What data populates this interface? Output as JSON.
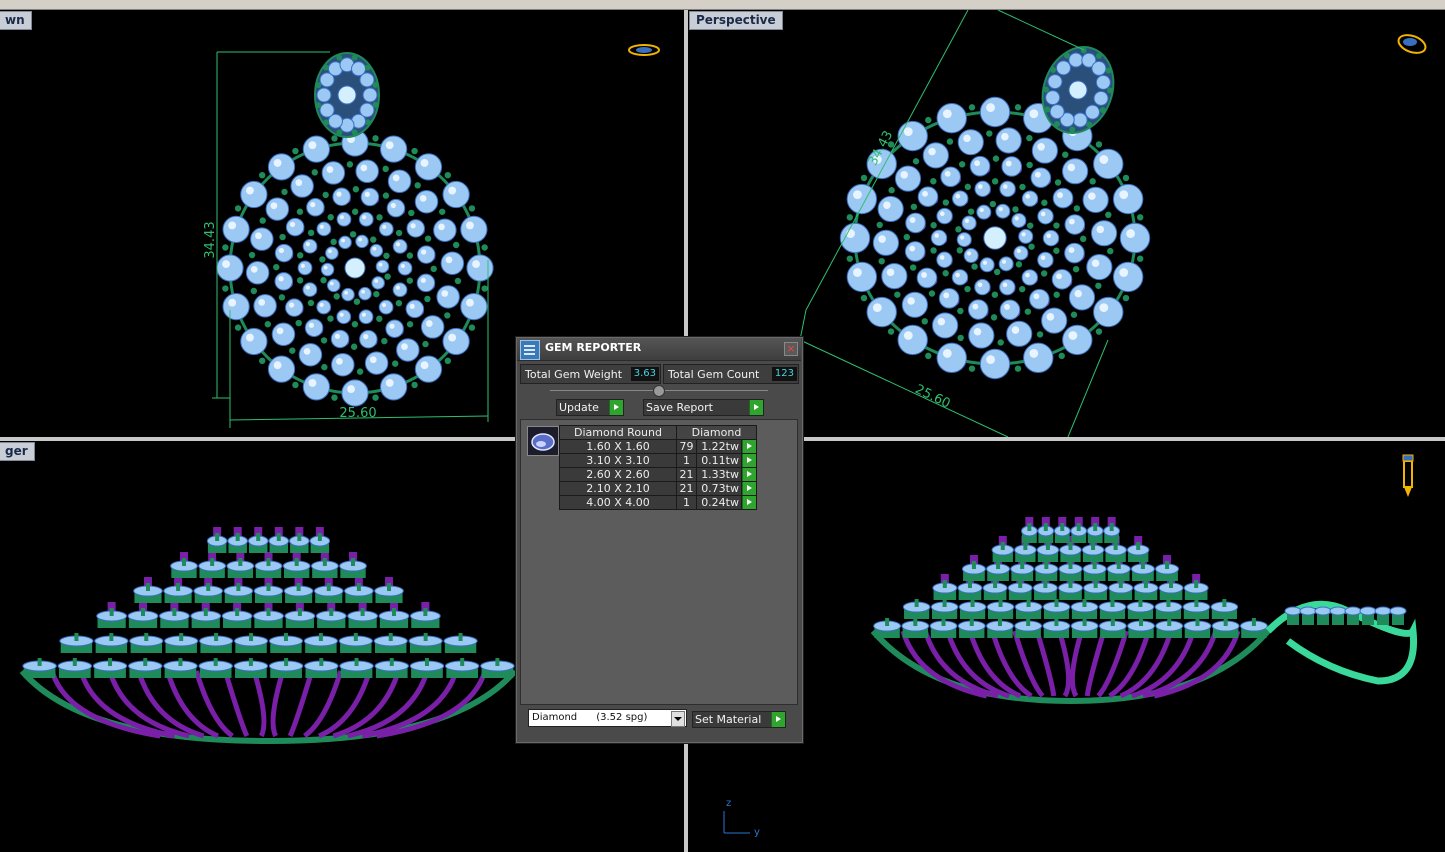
{
  "viewports": {
    "top": {
      "label": "wn",
      "dim_height": "34.43",
      "dim_width": "25.60"
    },
    "perspective": {
      "label": "Perspective",
      "dim_height": "34.43",
      "dim_width": "25.60"
    },
    "front": {
      "label": "ger"
    },
    "right": {
      "label": ""
    }
  },
  "axes": {
    "z": "z",
    "y": "y"
  },
  "gem_reporter": {
    "title": "GEM REPORTER",
    "total_weight_label": "Total Gem Weight",
    "total_weight_value": "3.63",
    "total_count_label": "Total Gem Count",
    "total_count_value": "123",
    "update_label": "Update",
    "save_report_label": "Save Report",
    "table": {
      "shape_header": "Diamond Round",
      "material_header": "Diamond",
      "rows": [
        {
          "size": "1.60 X 1.60",
          "count": "79",
          "weight": "1.22tw"
        },
        {
          "size": "3.10 X 3.10",
          "count": "1",
          "weight": "0.11tw"
        },
        {
          "size": "2.60 X 2.60",
          "count": "21",
          "weight": "1.33tw"
        },
        {
          "size": "2.10 X 2.10",
          "count": "21",
          "weight": "0.73tw"
        },
        {
          "size": "4.00 X 4.00",
          "count": "1",
          "weight": "0.24tw"
        }
      ]
    },
    "material_select": "Diamond      (3.52 spg)",
    "set_material_label": "Set Material"
  },
  "colors": {
    "gem_blue": "#9cc8f4",
    "gem_outline": "#3a6fc0",
    "prong_green": "#1f8a5a",
    "accent_purple": "#7a1fa8",
    "dimension_green": "#2fbf6f",
    "ok_green": "#2fa52f",
    "value_cyan": "#43d4e0"
  }
}
